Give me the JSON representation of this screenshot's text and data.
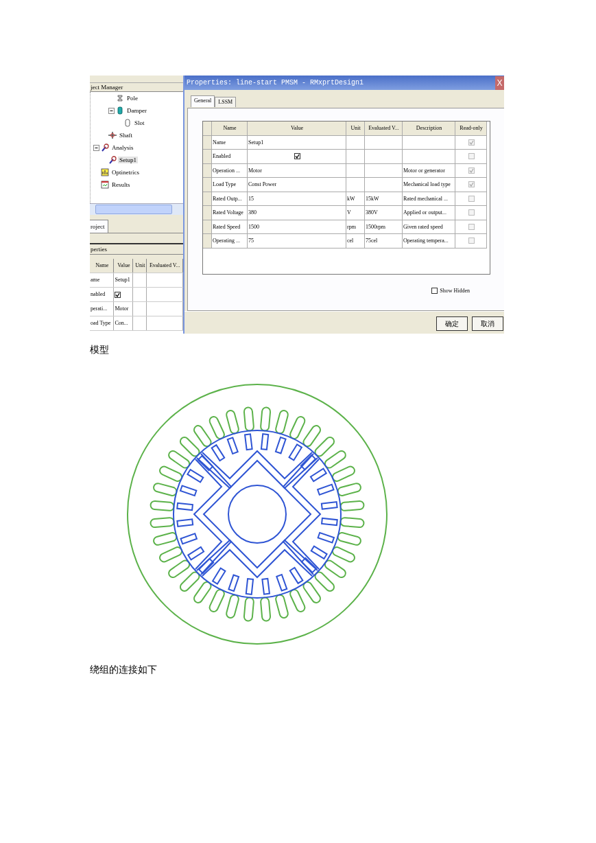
{
  "screenshot": {
    "left_panel": {
      "header": "ject Manager",
      "tree": [
        {
          "children": [
            {
              "children": [
                {
                  "label": "Pole",
                  "kind": "pole"
                },
                {
                  "label": "Damper",
                  "kind": "damper",
                  "expanded": true,
                  "children": [
                    {
                      "label": "Slot",
                      "kind": "slot"
                    }
                  ]
                }
              ]
            },
            {
              "label": "Shaft",
              "kind": "shaft"
            }
          ]
        },
        {
          "label": "Analysis",
          "kind": "analysis",
          "expanded": true,
          "children": [
            {
              "label": "Setup1",
              "kind": "setup",
              "selected": true
            }
          ]
        },
        {
          "label": "Optinetrics",
          "kind": "optimetrics",
          "selected": false
        },
        {
          "label": "Results",
          "kind": "results",
          "selected": false
        }
      ],
      "tab": "roject",
      "properties_header": "perties",
      "columns": [
        "Name",
        "Value",
        "Unit",
        "Evaluated V..."
      ],
      "rows": [
        {
          "name": "ame",
          "kind": "text",
          "value": "Setup1"
        },
        {
          "name": "nabled",
          "kind": "checkbox",
          "checked": true
        },
        {
          "name": "perati...",
          "kind": "text",
          "value": "Motor"
        },
        {
          "name": "oad Type",
          "kind": "text",
          "value": "Con..."
        }
      ]
    },
    "dialog": {
      "title": "Properties: line-start PMSM - RMxprtDesign1",
      "close": "X",
      "tabs": [
        {
          "label": "General",
          "selected": true
        },
        {
          "label": "LSSM",
          "selected": false
        }
      ],
      "columns": [
        "Name",
        "Value",
        "Unit",
        "Evaluated V...",
        "Description",
        "Read-only"
      ],
      "rows": [
        {
          "name": "Name",
          "kind": "text",
          "value": "Setup1",
          "read_only": true
        },
        {
          "name": "Enabled",
          "kind": "checkbox",
          "checked": true,
          "read_only": false
        },
        {
          "name": "Operation ...",
          "kind": "text",
          "value": "Motor",
          "description": "Motor or generator",
          "read_only": true
        },
        {
          "name": "Load Type",
          "kind": "text",
          "value": "Const Power",
          "description": "Mechanical load type",
          "read_only": true
        },
        {
          "name": "Rated Outp...",
          "kind": "text",
          "value": "15",
          "unit": "kW",
          "evaluated": "15kW",
          "description": "Rated mechanical ...",
          "read_only": false
        },
        {
          "name": "Rated Voltage",
          "kind": "text",
          "value": "380",
          "unit": "V",
          "evaluated": "380V",
          "description": "Applied or output...",
          "read_only": false
        },
        {
          "name": "Rated Speed",
          "kind": "text",
          "value": "1500",
          "unit": "rpm",
          "evaluated": "1500rpm",
          "description": "Given rated speed",
          "read_only": false
        },
        {
          "name": "Operating ...",
          "kind": "text",
          "value": "75",
          "unit": "cel",
          "evaluated": "75cel",
          "description": "Operating tempera...",
          "read_only": false
        }
      ],
      "show_hidden": {
        "label": "Show Hidden",
        "checked": false
      },
      "buttons": [
        "确定",
        "取消"
      ]
    }
  },
  "caption": "模型",
  "paragraph": "绕组的连接如下"
}
